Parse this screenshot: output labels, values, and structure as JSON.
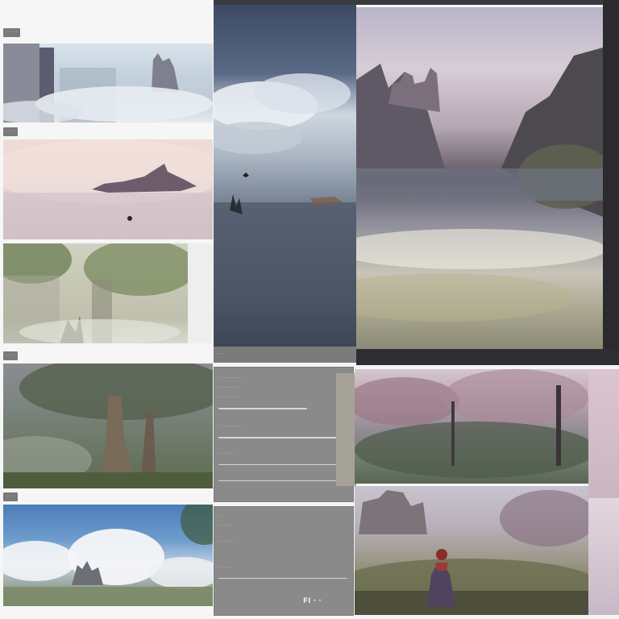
{
  "left_column": {
    "chips": [
      {
        "label": "· · · ·"
      },
      {
        "label": "· · ·"
      },
      {
        "label": "· · ·"
      },
      {
        "label": "· · ·"
      }
    ]
  },
  "panels": {
    "panel_1": {
      "lines": [
        "· · · · · · · · · ·",
        "· · · · · · · · ·",
        "· · · · · · · ·",
        "· · · · · · · · · ·",
        "· · · · · · ·"
      ]
    },
    "panel_2": {
      "lines": [
        "· · ·",
        "· · · · · ·",
        "· · · · · · ·",
        "· · · · · ·"
      ],
      "footer": "FI · ·"
    }
  },
  "canvas_a_footer": "· · ·",
  "colors": {
    "background": "#f4f4f4",
    "chip": "#7a7a7a",
    "panel": "#8a8a8a",
    "dark_strip": "#2b2b2e"
  },
  "icons": {
    "bird": "bird-silhouette-icon",
    "figure": "red-cloaked-figure-icon"
  }
}
